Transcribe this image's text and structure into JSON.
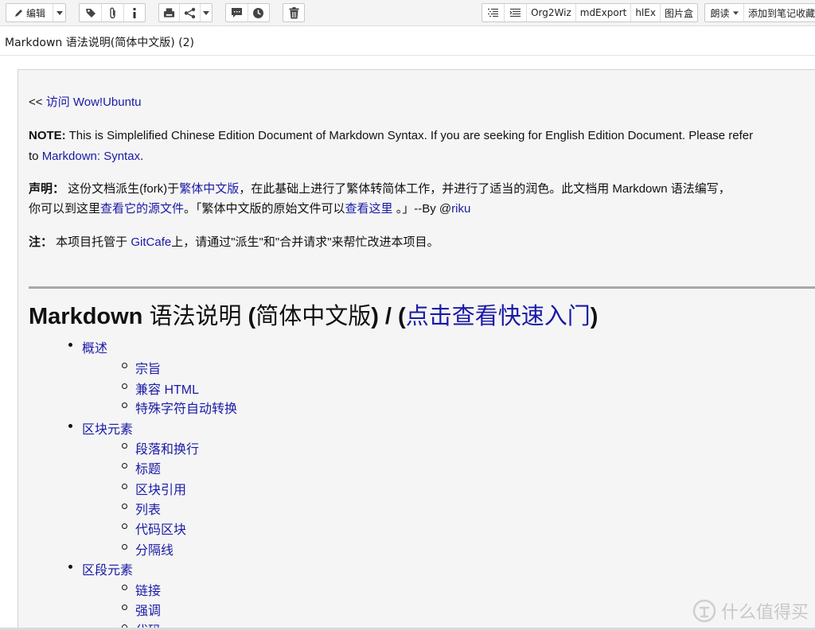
{
  "toolbar": {
    "edit_label": "编辑",
    "org2wiz_label": "Org2Wiz",
    "mdexport_label": "mdExport",
    "hlex_label": "hlEx",
    "images_label": "图片盒",
    "read_label": "朗读",
    "favorite_label": "添加到笔记收藏"
  },
  "doc": {
    "title": "Markdown 语法说明(简体中文版) (2)"
  },
  "content": {
    "visit_prefix": "<< ",
    "visit_text": "访问",
    "visit_link": "Wow!Ubuntu",
    "note_label": "NOTE:",
    "note_text": " This is Simplelified Chinese Edition Document of Markdown Syntax. If you are seeking for English Edition Document. Please refer",
    "note_line2_prefix": "to ",
    "note_link": "Markdown: Syntax",
    "note_line2_suffix": ".",
    "decl_label": "声明：",
    "decl_text1": " 这份文档派生(fork)于",
    "decl_link1": "繁体中文版",
    "decl_text2": "，在此基础上进行了繁体转简体工作，并进行了适当的润色。此文档用 Markdown 语法编写，",
    "decl_line2_text1": "你可以到这里",
    "decl_link2": "查看它的源文件",
    "decl_line2_text2": "。「繁体中文版的原始文件可以",
    "decl_link3": "查看这里",
    "decl_line2_text3": " 。」--By @",
    "decl_link4": "riku",
    "zhu_label": "注：",
    "zhu_text1": " 本项目托管于 ",
    "zhu_link": "GitCafe",
    "zhu_text2": "上，请通过\"派生\"和\"合并请求\"来帮忙改进本项目。",
    "h1_a": "Markdown",
    "h1_b": " 语法说明 ",
    "h1_c": "(",
    "h1_d": "简体中文版",
    "h1_e": ") / (",
    "h1_link": "点击查看快速入门",
    "h1_f": ")"
  },
  "toc": {
    "overview": "概述",
    "overview_items": [
      "宗旨",
      "兼容 HTML",
      "特殊字符自动转换"
    ],
    "block": "区块元素",
    "block_items": [
      "段落和换行",
      "标题",
      "区块引用",
      "列表",
      "代码区块",
      "分隔线"
    ],
    "span": "区段元素",
    "span_items": [
      "链接",
      "强调",
      "代码"
    ]
  },
  "watermark": {
    "text": "什么值得买"
  }
}
